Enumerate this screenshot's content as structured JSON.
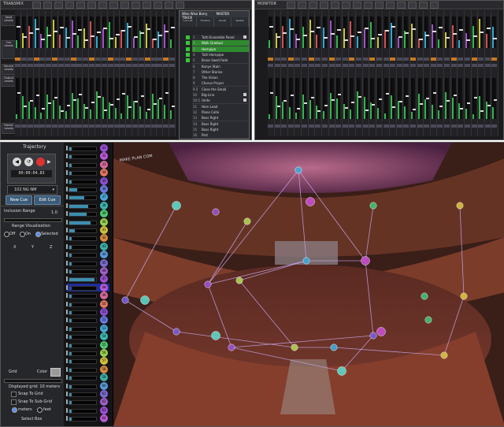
{
  "mixer_left": {
    "title": "TRANSMIX",
    "side_labels": [
      "Send Levels",
      "Cue Levels",
      "Source Levels",
      "Output Levels",
      "Stereo Levels"
    ]
  },
  "mixer_right": {
    "title": "MONITOR"
  },
  "cue_panel": {
    "title": "Wise Wise Barry",
    "subtitle": "MASTER TRACK",
    "tabs": [
      "Cue List",
      "Timeline",
      "Sends",
      "Spatial"
    ],
    "rows": [
      {
        "n": "1",
        "label": "Tutti Ensemble Panel"
      },
      {
        "n": "2",
        "label": "Walk Gradual"
      },
      {
        "n": "3",
        "label": "Hornpipe"
      },
      {
        "n": "4",
        "label": "Tutti Hornpipe"
      },
      {
        "n": "5",
        "label": "Brass Swell Fade"
      },
      {
        "n": "6",
        "label": "Kanye Stain"
      },
      {
        "n": "7",
        "label": "Other Stories"
      },
      {
        "n": "8",
        "label": "The Vision"
      },
      {
        "n": "9",
        "label": "Chorus Prayer"
      },
      {
        "n": "9.5",
        "label": "Close the Small"
      },
      {
        "n": "10",
        "label": "Big-Line"
      },
      {
        "n": "10.5",
        "label": "Unite"
      },
      {
        "n": "11",
        "label": "Horn Lead"
      },
      {
        "n": "12",
        "label": "Piano Cello"
      },
      {
        "n": "13",
        "label": "Bass Right"
      },
      {
        "n": "14",
        "label": "Bass Right"
      },
      {
        "n": "15",
        "label": "Bass Right"
      },
      {
        "n": "16",
        "label": "Part"
      }
    ]
  },
  "trajectory": {
    "title": "Trajectory",
    "time": "00:00:04.83",
    "preset": "102 NG NM",
    "new_cue": "New Cue",
    "edit_cue": "Edit Cue",
    "inclusion_range_label": "Inclusion Range",
    "inclusion_range_value": "1.0",
    "range_vis_label": "Range Visualization",
    "range_options": [
      "Off",
      "On",
      "Selected"
    ],
    "axes": [
      "X",
      "Y",
      "Z"
    ],
    "grid_label": "Grid",
    "color_label": "Color",
    "displayed_grid": "Displayed grid: 10 meters",
    "snap_grid": "Snap To Grid",
    "snap_subgrid": "Snap To Sub-Grid",
    "units": [
      "meters",
      "feet"
    ],
    "select_box": "Select Box"
  },
  "sources": {
    "labels": [
      "31",
      "32",
      "33",
      "34",
      "35",
      "36",
      "37",
      "38",
      "39",
      "40",
      "41",
      "42",
      "43",
      "44",
      "45",
      "46",
      "47",
      "48",
      "49",
      "50",
      "51",
      "52",
      "53",
      "54",
      "55",
      "56",
      "57",
      "58",
      "59",
      "60",
      "61",
      "62",
      "63",
      "64"
    ],
    "levels": [
      0.1,
      0.1,
      0.1,
      0.1,
      0.1,
      0.3,
      0.55,
      0.7,
      0.65,
      0.8,
      0.2,
      0.1,
      0.1,
      0.1,
      0.1,
      0.1,
      0.95,
      0.1,
      0.1,
      0.1,
      0.1,
      0.1,
      0.1,
      0.1,
      0.1,
      0.1,
      0.1,
      0.1,
      0.1,
      0.1,
      0.1,
      0.1,
      0.1,
      0.1
    ]
  },
  "hall": {
    "watermark": "MAKE PLAN COM"
  }
}
